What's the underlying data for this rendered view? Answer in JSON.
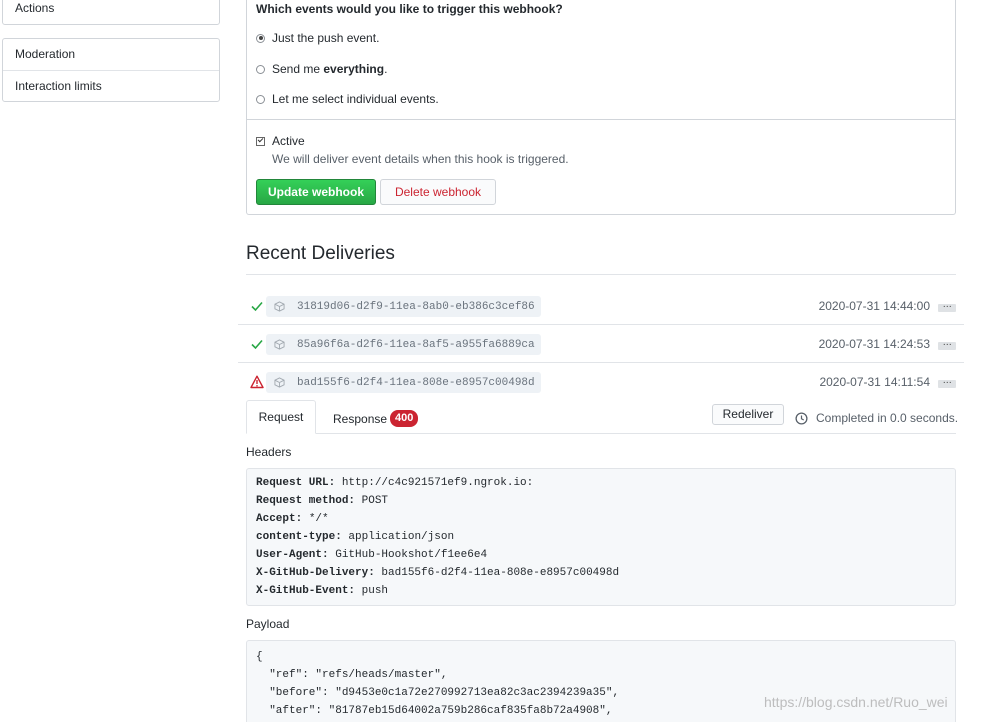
{
  "sidebar": {
    "top_items": [
      "Actions"
    ],
    "moderation": {
      "header": "Moderation",
      "items": [
        "Interaction limits"
      ]
    }
  },
  "events": {
    "question": "Which events would you like to trigger this webhook?",
    "options": [
      {
        "label_prefix": "Just the push event.",
        "label_bold": "",
        "selected": true
      },
      {
        "label_prefix": "Send me ",
        "label_bold": "everything",
        "label_suffix": ".",
        "selected": false
      },
      {
        "label_prefix": "Let me select individual events.",
        "label_bold": "",
        "selected": false
      }
    ],
    "active_label": "Active",
    "active_checked": true,
    "active_note": "We will deliver event details when this hook is triggered.",
    "update_button": "Update webhook",
    "delete_button": "Delete webhook"
  },
  "recent": {
    "title": "Recent Deliveries",
    "deliveries": [
      {
        "status": "success",
        "guid": "31819d06-d2f9-11ea-8ab0-eb386c3cef86",
        "time": "2020-07-31 14:44:00"
      },
      {
        "status": "success",
        "guid": "85a96f6a-d2f6-11ea-8af5-a955fa6889ca",
        "time": "2020-07-31 14:24:53"
      },
      {
        "status": "error",
        "guid": "bad155f6-d2f4-11ea-808e-e8957c00498d",
        "time": "2020-07-31 14:11:54"
      }
    ],
    "ellipsis": "…"
  },
  "detail": {
    "tab_request": "Request",
    "tab_response": "Response",
    "response_code": "400",
    "redeliver_button": "Redeliver",
    "completed_text": "Completed in 0.0 seconds.",
    "headers_label": "Headers",
    "headers": [
      {
        "key": "Request URL:",
        "value": " http://c4c921571ef9.ngrok.io:"
      },
      {
        "key": "Request method:",
        "value": " POST"
      },
      {
        "key": "Accept:",
        "value": " */*"
      },
      {
        "key": "content-type:",
        "value": " application/json"
      },
      {
        "key": "User-Agent:",
        "value": " GitHub-Hookshot/f1ee6e4"
      },
      {
        "key": "X-GitHub-Delivery:",
        "value": " bad155f6-d2f4-11ea-808e-e8957c00498d"
      },
      {
        "key": "X-GitHub-Event:",
        "value": " push"
      }
    ],
    "payload_label": "Payload",
    "payload_lines": [
      "{",
      "  \"ref\": \"refs/heads/master\",",
      "  \"before\": \"d9453e0c1a72e270992713ea82c3ac2394239a35\",",
      "  \"after\": \"81787eb15d64002a759b286caf835fa8b72a4908\","
    ]
  },
  "watermark": "https://blog.csdn.net/Ruo_wei",
  "colors": {
    "success": "#28a745",
    "error": "#cb2431",
    "primary_button": "#2ea44f"
  }
}
